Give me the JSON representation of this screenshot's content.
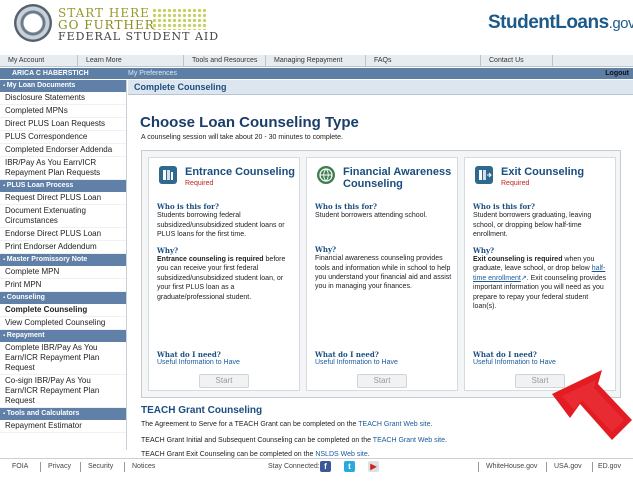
{
  "header": {
    "brand_line1": "START HERE",
    "brand_line2": "GO FURTHER",
    "brand_line3": "FEDERAL STUDENT AID",
    "studentloans": "StudentLoans",
    "studentloans_suffix": ".gov"
  },
  "nav": {
    "items": [
      "My Account",
      "Learn More",
      "Tools and Resources",
      "Managing Repayment",
      "FAQs",
      "Contact Us"
    ]
  },
  "userbar": {
    "name": "ARICA C HABERSTICH",
    "preferences": "My Preferences",
    "logout": "Logout"
  },
  "sidebar": {
    "sections": [
      {
        "title": "My Loan Documents",
        "items": [
          "Disclosure Statements",
          "Completed MPNs",
          "Direct PLUS Loan Requests",
          "PLUS Correspondence",
          "Completed Endorser Addenda",
          "IBR/Pay As You Earn/ICR Repayment Plan Requests"
        ]
      },
      {
        "title": "PLUS Loan Process",
        "items": [
          "Request Direct PLUS Loan",
          "Document Extenuating Circumstances",
          "Endorse Direct PLUS Loan",
          "Print Endorser Addendum"
        ]
      },
      {
        "title": "Master Promissory Note",
        "items": [
          "Complete MPN",
          "Print MPN"
        ]
      },
      {
        "title": "Counseling",
        "items": [
          "Complete Counseling",
          "View Completed Counseling"
        ]
      },
      {
        "title": "Repayment",
        "items": [
          "Complete IBR/Pay As You Earn/ICR Repayment Plan Request",
          "Co-sign IBR/Pay As You Earn/ICR Repayment Plan Request"
        ]
      },
      {
        "title": "Tools and Calculators",
        "items": [
          "Repayment Estimator"
        ]
      }
    ]
  },
  "main": {
    "breadcrumb": "Complete Counseling",
    "title": "Choose Loan Counseling Type",
    "subtitle": "A counseling session will take about 20 - 30 minutes to complete.",
    "cards": [
      {
        "title": "Entrance Counseling",
        "required": "Required",
        "who_q": "Who is this for?",
        "who_a": "Students borrowing federal subsidized/unsubsidized student loans or PLUS loans for the first time.",
        "why_q": "Why?",
        "why_strong": "Entrance counseling is required",
        "why_a": " before you can receive your first federal subsidized/unsubsidized student loan, or your first PLUS loan as a graduate/professional student.",
        "need_q": "What do I need?",
        "need_link": "Useful Information to Have",
        "start": "Start",
        "icon": "book-icon",
        "icon_color": "#2f6a8e"
      },
      {
        "title": "Financial Awareness Counseling",
        "required": "",
        "who_q": "Who is this for?",
        "who_a": "Student borrowers attending school.",
        "why_q": "Why?",
        "why_strong": "",
        "why_a": "Financial awareness counseling provides tools and information while in school to help you understand your financial aid and assist you in managing your finances.",
        "need_q": "What do I need?",
        "need_link": "Useful Information to Have",
        "start": "Start",
        "icon": "globe-icon",
        "icon_color": "#3f7f52"
      },
      {
        "title": "Exit Counseling",
        "required": "Required",
        "who_q": "Who is this for?",
        "who_a": "Student borrowers graduating, leaving school, or dropping below half-time enrollment.",
        "why_q": "Why?",
        "why_strong": "Exit counseling is required",
        "why_a_pre": " when you graduate, leave school, or drop below ",
        "why_link": "half-time enrollment",
        "why_a_post": ". Exit counseling provides important information you will need as you prepare to repay your federal student loan(s).",
        "need_q": "What do I need?",
        "need_link": "Useful Information to Have",
        "start": "Start",
        "icon": "exit-door-icon",
        "icon_color": "#2f6a8e"
      }
    ],
    "teach": {
      "title": "TEACH Grant Counseling",
      "line1_pre": "The Agreement to Serve for a TEACH Grant can be completed on the ",
      "line1_link": "TEACH Grant Web site",
      "line1_post": ".",
      "line2_pre": "TEACH Grant Initial and Subsequent Counseling can be completed on the ",
      "line2_link": "TEACH Grant Web site",
      "line2_post": ".",
      "line3_pre": "TEACH Grant Exit Counseling can be completed on the ",
      "line3_link": "NSLDS Web site",
      "line3_post": "."
    }
  },
  "footer": {
    "links_left": [
      "FOIA",
      "Privacy",
      "Security",
      "Notices"
    ],
    "stay_connected": "Stay Connected:",
    "social": [
      "facebook-icon",
      "twitter-icon",
      "youtube-icon"
    ],
    "links_right": [
      "WhiteHouse.gov",
      "USA.gov",
      "ED.gov"
    ]
  },
  "colors": {
    "accent": "#1a4d80",
    "userbar": "#5d7fa6",
    "required": "#c0241d",
    "arrow": "#e31b23"
  }
}
